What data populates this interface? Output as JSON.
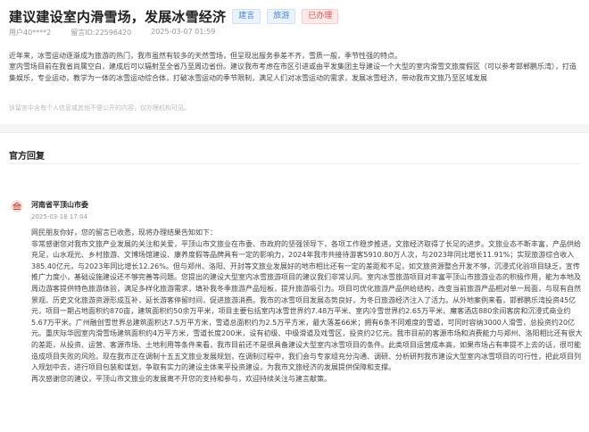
{
  "header": {
    "title": "建议建设室内滑雪场，发展冰雪经济",
    "tags": {
      "t1": "建言",
      "t2": "旅游",
      "t3": "已办理"
    }
  },
  "meta": {
    "user": "用户40****2",
    "msg_id": "留言ID:22596420",
    "time": "2025-03-07 01:59"
  },
  "message": {
    "p1": "近年来，冰雪运动逐渐成为旅游的热门，我市虽然有较多的天然雪场，但呈现出服务参差不齐，雪质一般，季节性强的特点。",
    "p2": "室内雪场目前在我省尚属空白，建成后可以辐射至全省乃至周边省份。建议我市考虑在市区引进或由平发集团主导建设一个大型的室内滑雪文旅度假区（可以参考邯郸鹏乐湾），打造集娱乐，专业运动，教学为一体的冰雪运动综合体，打破冰雪运动的季节限制，满足人们对冰雪运动的需求，发展冰雪经济，带动我市文旅乃至区域发展",
    "note": "该留言中含有个人信息或其他不便公开的内容，仅办理机构可见。"
  },
  "section": {
    "title": "官方回复"
  },
  "reply": {
    "org": "河南省平顶山市委",
    "time": "2025-03-18 17:04",
    "greeting": "网民朋友你好，您的留言已收悉，现将办理结果告知如下：",
    "body": "非常感谢您对我市文旅产业发展的关注和关爱，平顶山市文旅业在市委、市政府的坚强领导下，各项工作稳步推进，文旅经济取得了长足的进步。文旅业态不断丰富，产品供给充足，山水观光、乡村旅游、文博场馆建设、康养度假等品牌具有一定的影响力，2024年我市共接待游客5910.80万人次，与2023年同比增长11.91%；实现旅游综合收入385.40亿元，与2023年同比增长12.26%。但与郑州、洛阳、开封等文旅业发展好的地市相比还有一定的差距和不足，如文旅资源整合开发不够，沉浸式化验项目缺乏，宣传推广力度小，基础设施建设还不够完善等问题。您提出的建设大型室内冰雪旅游项目的建议我们非常认同。室内冰雪旅游项目对丰富平顶山市旅游业态的积极作用，能为本地及周边游客提供特色旅游体验，满足多样化旅游需求，填补我冬季旅游产品短板，提升旅游吸引力。项目可优化旅游产品供给结构，改变当前旅游产品相对单一局面，与现有自然景观、历史文化旅游资源形成互补，延长游客停留时间，促进旅游消费。我市的冰雪项目发展态势良好，为冬日旅游经济注入了活力。从外地案例来看，邯郸鹏乐湾投资45亿元，项目一期占地面积约870亩，建筑面积约50余万平米，项目主要包括室内冰雪世界约7.48万平米、室内冷雪世界约2.65万平米、魔客酒店880余间客房和沉浸式商业约5.67万平米。广州融创雪世界总建筑面积达7.5万平方米，雪道总面积约为2.5万平方米，最大落差66米；拥有6条不同难度的雪道，可同时容纳3000人滑雪，总投资约20亿元。重庆际华园室内滑雪场建筑面积约4万平方米，雪道长度200米，设有初级、中级滑道及戏雪区，投资约2亿元。我市目前的客源市场和消费能力与郑州、洛阳相比还有很大的差距，从投资、运营、客源市场、土地利用等条件来看，我市目前还不是很具备建设大型室内冰雪项目的条件。此类项目运营成本高，如果市场占有率提不上去的话，很可能造成项目失败的风险。现在我市正在调制十五五文旅业发展规划，在调制过程中，我们会与专家组充分沟通、调研、分析研判我市建设大型室内冰雪项目的可行性，把此项目列入规划中去，进行项目包装和谋划，争取有实力的建设主体来平投资建设，为我市文旅经济的发展提供保障和支撑。",
    "closing": "再次感谢您的建议，平顶山市文旅业的发展离不开您的支持和参与，欢迎持续关注与建言献策。"
  },
  "colors": {
    "tag_blue": "#4b86d8",
    "tag_red": "#e0524d",
    "org_icon": "#c94a3a"
  },
  "icons": {
    "org": "government-emblem-icon"
  }
}
